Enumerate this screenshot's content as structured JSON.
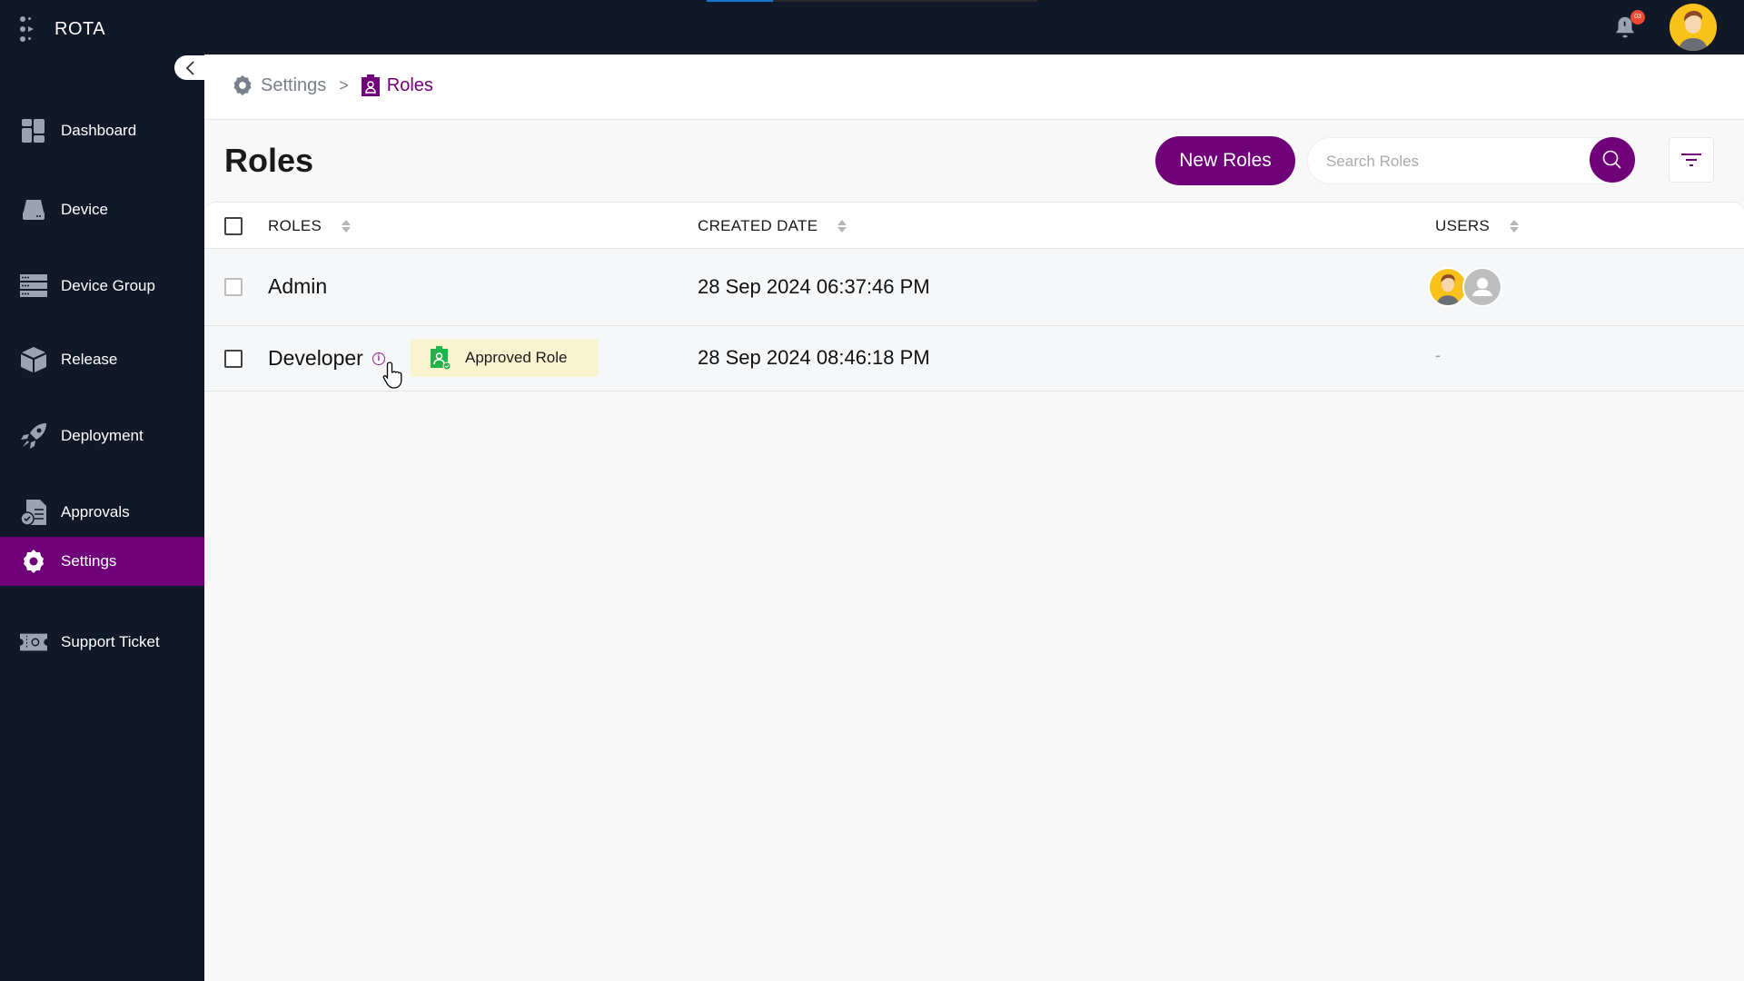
{
  "app": {
    "name": "ROTA",
    "notification_count": "03",
    "loading_progress_percent": 20
  },
  "sidebar": {
    "items": [
      {
        "label": "Dashboard",
        "icon": "dashboard-icon",
        "active": false
      },
      {
        "label": "Device",
        "icon": "device-icon",
        "active": false
      },
      {
        "label": "Device Group",
        "icon": "server-stack-icon",
        "active": false
      },
      {
        "label": "Release",
        "icon": "package-icon",
        "active": false
      },
      {
        "label": "Deployment",
        "icon": "rocket-icon",
        "active": false
      },
      {
        "label": "Approvals",
        "icon": "approval-document-icon",
        "active": false
      },
      {
        "label": "Settings",
        "icon": "gear-icon",
        "active": true
      },
      {
        "label": "Support Ticket",
        "icon": "ticket-icon",
        "active": false
      }
    ]
  },
  "breadcrumb": {
    "items": [
      {
        "label": "Settings",
        "icon": "gear-icon"
      },
      {
        "label": "Roles",
        "icon": "badge-icon"
      }
    ],
    "separator": ">"
  },
  "page": {
    "title": "Roles",
    "new_button_label": "New Roles",
    "search_placeholder": "Search Roles",
    "search_value": ""
  },
  "table": {
    "columns": [
      "ROLES",
      "CREATED DATE",
      "USERS"
    ],
    "rows": [
      {
        "role": "Admin",
        "created": "28 Sep 2024 06:37:46 PM",
        "users": [
          "user-photo-avatar",
          "default-user-avatar"
        ],
        "badge": null
      },
      {
        "role": "Developer",
        "created": "28 Sep 2024 08:46:18 PM",
        "users": [],
        "users_placeholder": "-",
        "badge": "Approved Role"
      }
    ]
  },
  "colors": {
    "brand": "#6f0079",
    "sidebar_bg": "#111827",
    "badge_bg": "#faf3cf",
    "badge_icon": "#22b24c",
    "notification": "#f04a30"
  }
}
